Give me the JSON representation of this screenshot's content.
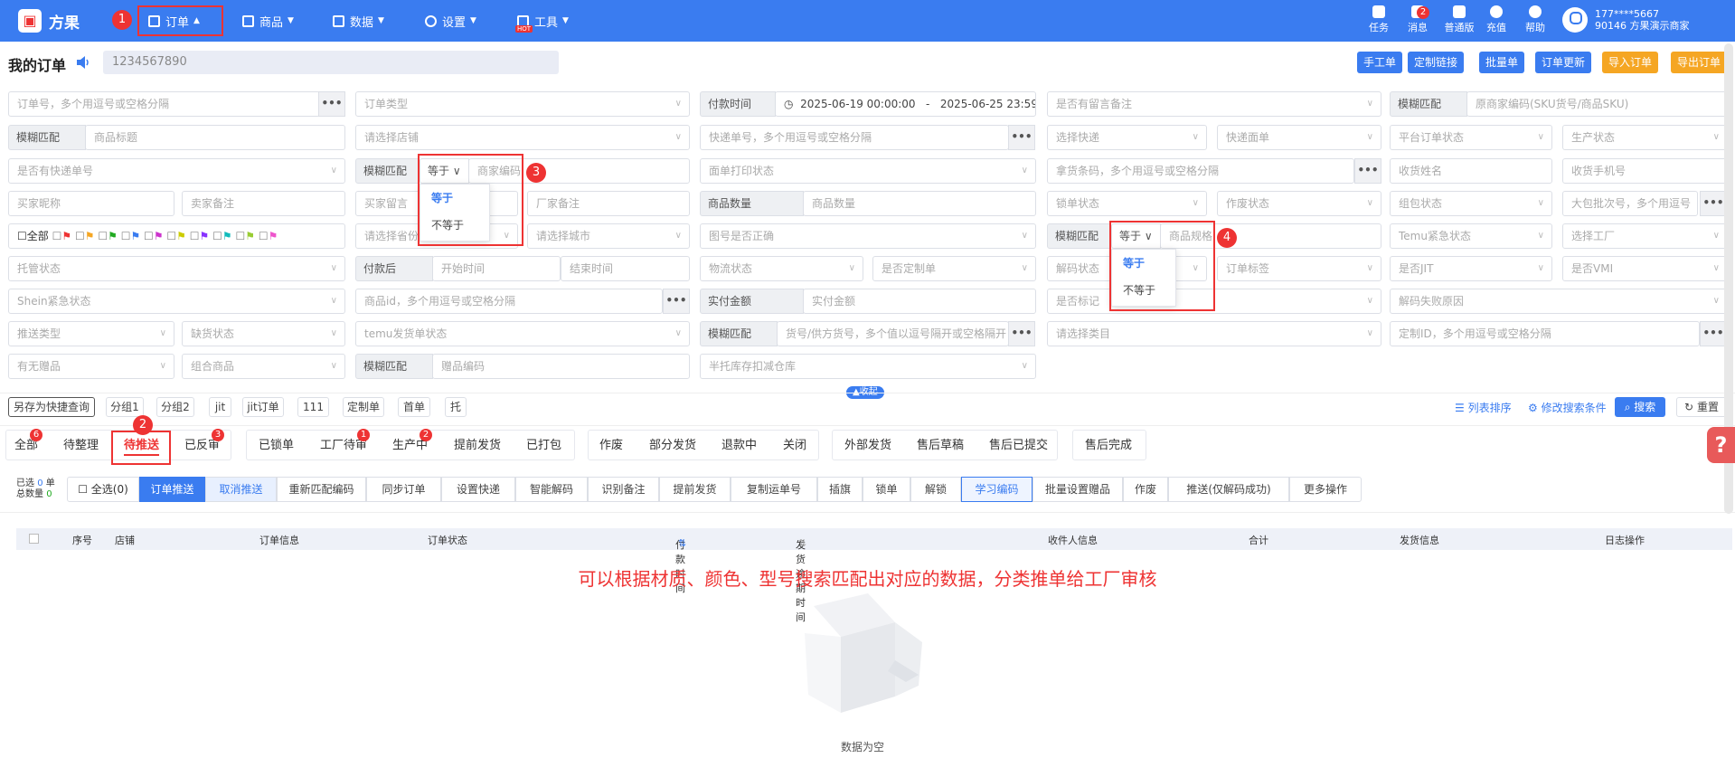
{
  "app": {
    "logo_glyph": "▣",
    "logo_text": "方果"
  },
  "nav": [
    {
      "label": "订单",
      "icon": "clipboard-icon",
      "caret": "▲"
    },
    {
      "label": "商品",
      "icon": "shirt-icon",
      "caret": "▼"
    },
    {
      "label": "数据",
      "icon": "chart-icon",
      "caret": "▼"
    },
    {
      "label": "设置",
      "icon": "gear-icon",
      "caret": "▼"
    },
    {
      "label": "工具",
      "icon": "toolbox-icon",
      "caret": "▼",
      "tag": "HOT"
    }
  ],
  "markers": [
    "1",
    "2",
    "3",
    "4"
  ],
  "right_nav": [
    {
      "label": "任务",
      "icon": "task-icon"
    },
    {
      "label": "消息",
      "icon": "message-icon",
      "badge": "2"
    },
    {
      "label": "普通版",
      "icon": "shirt-icon"
    },
    {
      "label": "充值",
      "icon": "coin-icon"
    },
    {
      "label": "帮助",
      "icon": "help-icon"
    }
  ],
  "user": {
    "phone": "177****5667",
    "account": "90146 方果演示商家"
  },
  "page": {
    "title": "我的订单",
    "notice": "1234567890"
  },
  "top_buttons": [
    {
      "label": "手工单",
      "color": "#3a7cf0"
    },
    {
      "label": "定制链接",
      "color": "#3a7cf0"
    },
    {
      "label": "批量单",
      "color": "#3a7cf0"
    },
    {
      "label": "订单更新",
      "color": "#3a7cf0"
    },
    {
      "label": "导入订单",
      "color": "#f5a623"
    },
    {
      "label": "导出订单",
      "color": "#f5a623"
    }
  ],
  "filters": {
    "r1": {
      "order_no": "订单号，多个用逗号或空格分隔",
      "order_type": "订单类型",
      "pay_time": "付款时间",
      "date_start": "2025-06-19 00:00:00",
      "date_sep": "-",
      "date_end": "2025-06-25 23:59:59",
      "remark": "是否有留言备注",
      "fuzzy": "模糊匹配",
      "merchant_code": "原商家编码(SKU货号/商品SKU)"
    },
    "r2": {
      "fuzzy": "模糊匹配",
      "product_title": "商品标题",
      "shop": "请选择店铺",
      "express_no": "快递单号，多个用逗号或空格分隔",
      "choose_express": "选择快递",
      "express_sheet": "快递面单",
      "platform_status": "平台订单状态",
      "production_status": "生产状态"
    },
    "r3": {
      "has_express": "是否有快递单号",
      "fuzzy": "模糊匹配",
      "eq": "等于",
      "merchant_code": "商家编码",
      "print_status": "面单打印状态",
      "pick_code": "拿货条码，多个用逗号或空格分隔",
      "receiver_name": "收货姓名",
      "receiver_phone": "收货手机号"
    },
    "r4": {
      "buyer_nick": "买家昵称",
      "seller_note": "卖家备注",
      "buyer_msg": "买家留言",
      "factory_note": "厂家备注",
      "qty_label": "商品数量",
      "qty": "商品数量",
      "lock_status": "锁单状态",
      "void_status": "作废状态",
      "group_status": "组包状态",
      "batch_no": "大包批次号，多个用逗号"
    },
    "r5": {
      "all": "全部",
      "province": "请选择省份",
      "city": "请选择城市",
      "img_correct": "图号是否正确",
      "fuzzy": "模糊匹配",
      "eq": "等于",
      "spec": "商品规格",
      "temu_urgent": "Temu紧急状态",
      "factory": "选择工厂"
    },
    "r6": {
      "custody": "托管状态",
      "after_pay": "付款后",
      "start_time": "开始时间",
      "end_time": "结束时间",
      "logistics": "物流状态",
      "custom": "是否定制单",
      "decode": "解码状态",
      "order_tag": "订单标签",
      "jit": "是否JIT",
      "vmi": "是否VMI"
    },
    "r7": {
      "shein_urgent": "Shein紧急状态",
      "product_id": "商品id，多个用逗号或空格分隔",
      "paid_label": "实付金额",
      "paid": "实付金额",
      "mark": "是否标记",
      "decode_fail": "解码失败原因"
    },
    "r8": {
      "push_type": "推送类型",
      "stock_status": "缺货状态",
      "temu_ship": "temu发货单状态",
      "fuzzy": "模糊匹配",
      "sku_no": "货号/供方货号，多个值以逗号隔开或空格隔开",
      "category": "请选择类目",
      "custom_id": "定制ID，多个用逗号或空格分隔"
    },
    "r9": {
      "gift": "有无赠品",
      "combo": "组合商品",
      "fuzzy": "模糊匹配",
      "gift_code": "赠品编码",
      "half_custody": "半托库存扣减仓库"
    }
  },
  "dropdown3": [
    "等于",
    "不等于"
  ],
  "dropdown4": [
    "等于",
    "不等于"
  ],
  "collapse": "▲收起",
  "quick_chips": [
    "另存为快捷查询",
    "分组1",
    "分组2",
    "jit",
    "jit订单",
    "111",
    "定制单",
    "首单",
    "托"
  ],
  "list_sort": "列表排序",
  "edit_conditions": "修改搜索条件",
  "search": "搜索",
  "reset": "重置",
  "tabs": [
    {
      "label": "全部",
      "badge": "6"
    },
    {
      "label": "待整理"
    },
    {
      "label": "待推送"
    },
    {
      "label": "已反审",
      "badge": "3"
    },
    {
      "label": "已锁单"
    },
    {
      "label": "工厂待审",
      "badge": "1"
    },
    {
      "label": "生产中",
      "badge": "2"
    },
    {
      "label": "提前发货"
    },
    {
      "label": "已打包"
    },
    {
      "label": "作废"
    },
    {
      "label": "部分发货"
    },
    {
      "label": "退款中"
    },
    {
      "label": "关闭"
    },
    {
      "label": "外部发货"
    },
    {
      "label": "售后草稿"
    },
    {
      "label": "售后已提交"
    },
    {
      "label": "售后完成"
    }
  ],
  "selected": {
    "l1": "已选",
    "v1": "0",
    "u1": "单",
    "l2": "总数量",
    "v2": "0"
  },
  "actions": [
    "全选(0)",
    "订单推送",
    "取消推送",
    "重新匹配编码",
    "同步订单",
    "设置快递",
    "智能解码",
    "识别备注",
    "提前发货",
    "复制运单号",
    "插旗",
    "锁单",
    "解锁",
    "学习编码",
    "批量设置赠品",
    "作废",
    "推送(仅解码成功)",
    "更多操作"
  ],
  "table_headers": [
    "序号",
    "店铺",
    "订单信息",
    "订单状态",
    "付款时间",
    "发货逾期时间",
    "收件人信息",
    "合计",
    "发货信息",
    "日志操作"
  ],
  "sort_glyph": "⇅",
  "annotation": "可以根据材质、颜色、型号搜索匹配出对应的数据，分类推单给工厂审核",
  "empty": "数据为空",
  "help": "?"
}
